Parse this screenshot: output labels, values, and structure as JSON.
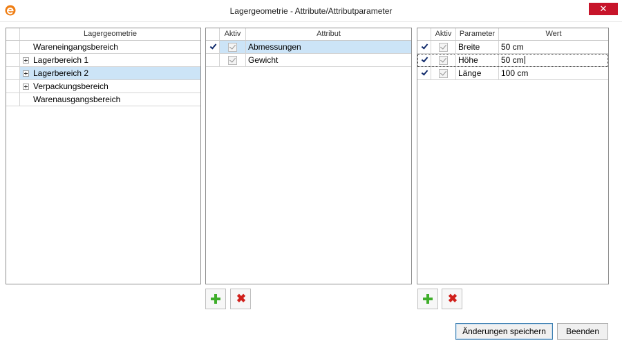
{
  "window": {
    "title": "Lagergeometrie - Attribute/Attributparameter",
    "close_glyph": "✕",
    "accent_color": "#c7142a",
    "app_icon": "app-logo-icon"
  },
  "left_panel": {
    "header": "Lagergeometrie",
    "items": [
      {
        "label": "Wareneingangsbereich",
        "expandable": false
      },
      {
        "label": "Lagerbereich 1",
        "expandable": true
      },
      {
        "label": "Lagerbereich 2",
        "expandable": true,
        "selected": true
      },
      {
        "label": "Verpackungsbereich",
        "expandable": true
      },
      {
        "label": "Warenausgangsbereich",
        "expandable": false
      }
    ]
  },
  "attribute_panel": {
    "headers": {
      "active": "Aktiv",
      "attribute": "Attribut"
    },
    "rows": [
      {
        "active": true,
        "name": "Abmessungen",
        "current": true
      },
      {
        "active": true,
        "name": "Gewicht",
        "current": false
      }
    ]
  },
  "parameter_panel": {
    "headers": {
      "active": "Aktiv",
      "parameter": "Parameter",
      "value": "Wert"
    },
    "rows": [
      {
        "active": true,
        "name": "Breite",
        "value": "50 cm",
        "current": true
      },
      {
        "active": true,
        "name": "Höhe",
        "value": "50 cm",
        "current": true,
        "editing": true
      },
      {
        "active": true,
        "name": "Länge",
        "value": "100 cm",
        "current": true
      }
    ]
  },
  "buttons": {
    "save": "Änderungen speichern",
    "close": "Beenden"
  }
}
